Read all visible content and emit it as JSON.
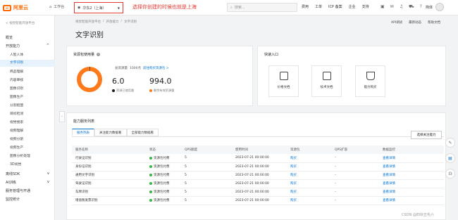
{
  "topbar": {
    "brand": "阿里云",
    "workbench": "工作台",
    "region": "华东2（上海）",
    "annotation": "选择你创建的时候也就是上海",
    "search_placeholder": "搜索...",
    "nav": [
      "费用",
      "工单",
      "ICP 备案",
      "企业",
      "支持"
    ],
    "user": "简体"
  },
  "sidebar": {
    "back": "< 视觉智能开放平台",
    "items": [
      {
        "label": "概览"
      },
      {
        "label": "开放能力"
      },
      {
        "label": "人脸人体",
        "sub": true
      },
      {
        "label": "文字识别",
        "sub": true,
        "active": true
      },
      {
        "label": "商品理解",
        "sub": true
      },
      {
        "label": "内容审核",
        "sub": true
      },
      {
        "label": "图像识别",
        "sub": true
      },
      {
        "label": "图像生产",
        "sub": true
      },
      {
        "label": "分割抠图",
        "sub": true
      },
      {
        "label": "目标检测",
        "sub": true
      },
      {
        "label": "视觉搜索",
        "sub": true
      },
      {
        "label": "视频理解",
        "sub": true
      },
      {
        "label": "视频分割",
        "sub": true
      },
      {
        "label": "视频生产",
        "sub": true
      },
      {
        "label": "图像分析处理",
        "sub": true
      },
      {
        "label": "3D视觉",
        "sub": true
      },
      {
        "label": "离线SDK"
      },
      {
        "label": "AI训练"
      },
      {
        "label": "服务管理与开通"
      },
      {
        "label": "监控统计"
      }
    ]
  },
  "main": {
    "breadcrumb": [
      "视觉智能开放平台",
      "/",
      "开放能力",
      "/",
      "文字识别"
    ],
    "title": "文字识别",
    "header_links": [
      "API调试",
      "最新动态",
      "帮助文档"
    ],
    "resource": {
      "title": "资源包使用量",
      "total_label": "总资源量",
      "total_value": "1000点",
      "buy_link": "前往购买资源包 >",
      "used": "6.0",
      "used_label": "资源已使用量",
      "remaining": "994.0",
      "remaining_label": "剩余有效资源量",
      "used_fraction": 0.006
    },
    "quick": {
      "title": "快速入口",
      "items": [
        "价格文档",
        "技术文档",
        "能力购买"
      ]
    },
    "service": {
      "title": "能力服务列表",
      "tabs": [
        "服务列表",
        "关注能力数据看",
        "全部能力数据看"
      ],
      "select_button": "选择关注能力",
      "columns": [
        "服务名称",
        "状态",
        "QPS额度",
        "使用时间",
        "资源包",
        "QPS扩容",
        "数据监控"
      ],
      "rows": [
        {
          "name": "行驶证识别",
          "status": "资源包付费",
          "qps": "5",
          "time": "2023-07-21 00:00:00",
          "pkg": "购买",
          "expand": "-",
          "monitor": "查看详情"
        },
        {
          "name": "身份证识别",
          "status": "资源包付费",
          "qps": "5",
          "time": "2023-07-21 00:00:00",
          "pkg": "购买",
          "expand": "-",
          "monitor": "查看详情"
        },
        {
          "name": "通用文字识别",
          "status": "资源包付费",
          "qps": "5",
          "time": "2023-07-21 00:00:00",
          "pkg": "购买",
          "expand": "-",
          "monitor": "查看详情"
        },
        {
          "name": "驾驶证识别",
          "status": "资源包付费",
          "qps": "5",
          "time": "2023-07-21 00:00:00",
          "pkg": "购买",
          "expand": "-",
          "monitor": "查看详情"
        },
        {
          "name": "车牌识别",
          "status": "资源包付费",
          "qps": "5",
          "time": "2023-07-21 00:00:00",
          "pkg": "购买",
          "expand": "-",
          "monitor": "查看详情"
        },
        {
          "name": "增值税发票识别",
          "status": "资源包付费",
          "qps": "5",
          "time": "2023-07-21 00:00:00",
          "pkg": "购买",
          "expand": "-",
          "monitor": "查看详情"
        }
      ]
    }
  },
  "watermark": "CSDN @四块五毛六",
  "colors": {
    "brand": "#ff6a00",
    "link": "#0070cc",
    "annotation": "#e53935",
    "ok": "#3ab54a"
  }
}
